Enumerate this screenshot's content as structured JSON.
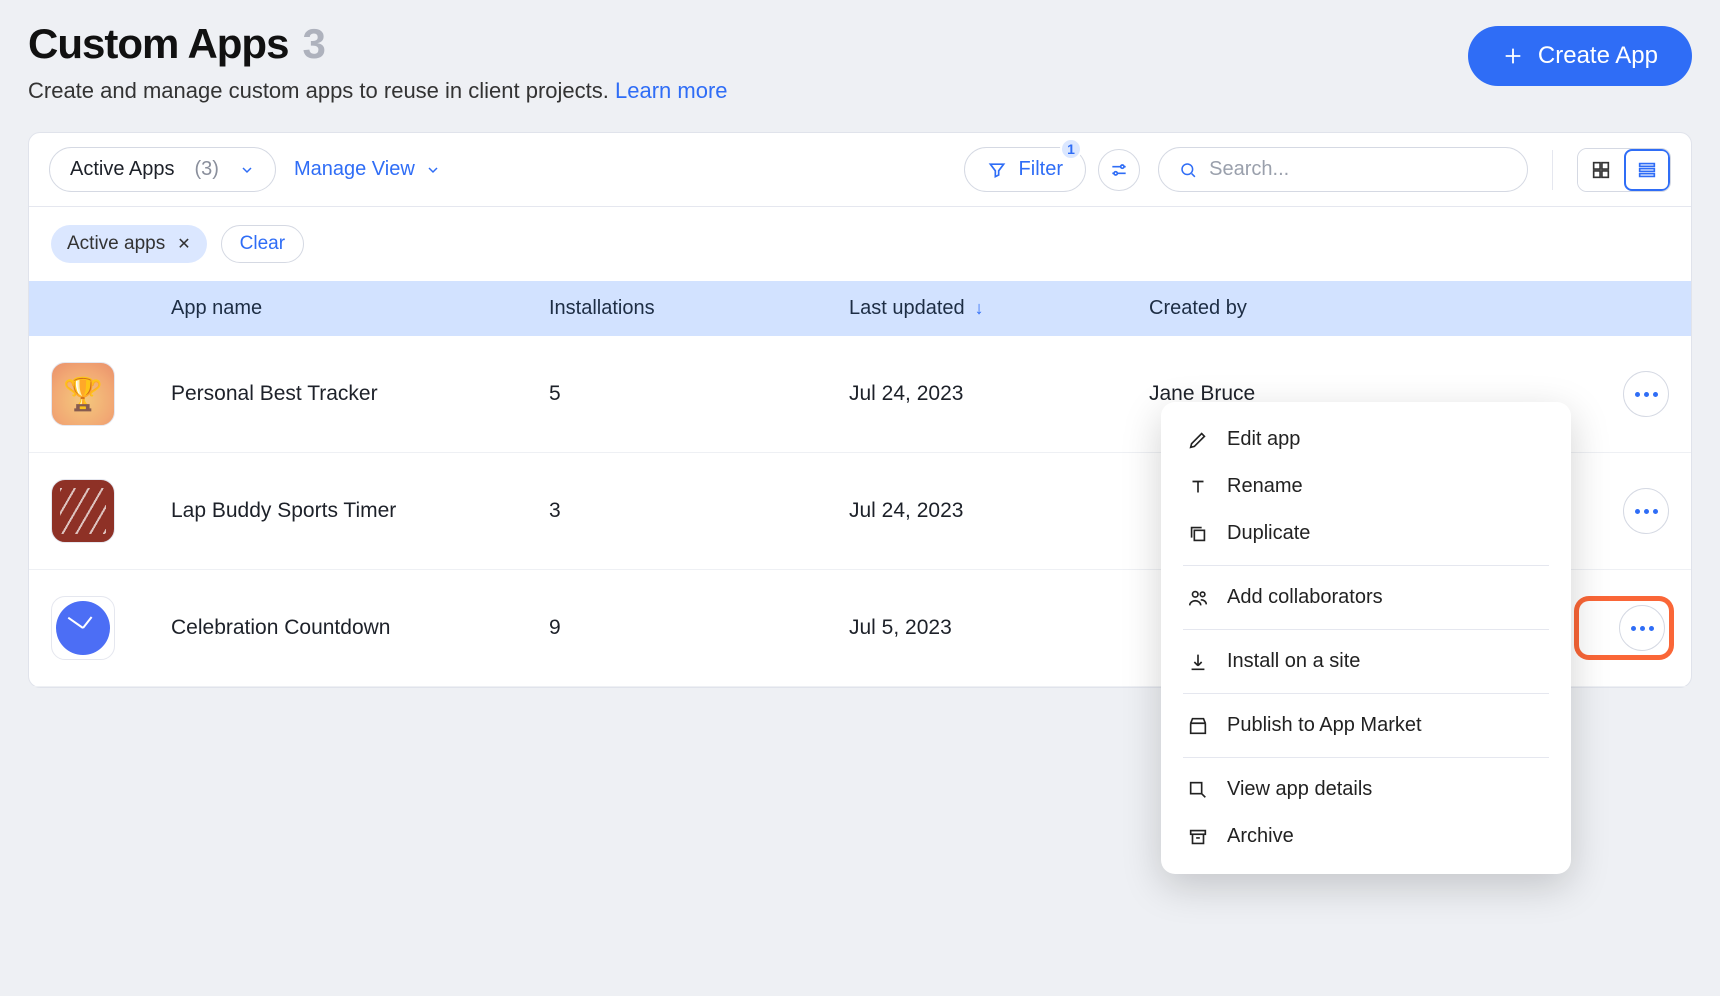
{
  "header": {
    "title": "Custom Apps",
    "count": "3",
    "subtitle": "Create and manage custom apps to reuse in client projects.",
    "learn_more": "Learn more",
    "create_label": "Create App"
  },
  "toolbar": {
    "view": {
      "label": "Active Apps",
      "count": "(3)"
    },
    "manage_view": "Manage View",
    "filter_label": "Filter",
    "filter_badge": "1",
    "search_placeholder": "Search..."
  },
  "chips": {
    "active_filter": "Active apps",
    "clear": "Clear"
  },
  "columns": {
    "app_name": "App name",
    "installations": "Installations",
    "last_updated": "Last updated",
    "created_by": "Created by"
  },
  "rows": [
    {
      "name": "Personal Best Tracker",
      "installations": "5",
      "updated": "Jul 24, 2023",
      "creator": "Jane Bruce",
      "icon": "trophy"
    },
    {
      "name": "Lap Buddy Sports Timer",
      "installations": "3",
      "updated": "Jul 24, 2023",
      "creator": "",
      "icon": "track"
    },
    {
      "name": "Celebration Countdown",
      "installations": "9",
      "updated": "Jul 5, 2023",
      "creator": "",
      "icon": "clock"
    }
  ],
  "menu": {
    "edit": "Edit app",
    "rename": "Rename",
    "duplicate": "Duplicate",
    "add_collaborators": "Add collaborators",
    "install": "Install on a site",
    "publish": "Publish to App Market",
    "details": "View app details",
    "archive": "Archive"
  }
}
